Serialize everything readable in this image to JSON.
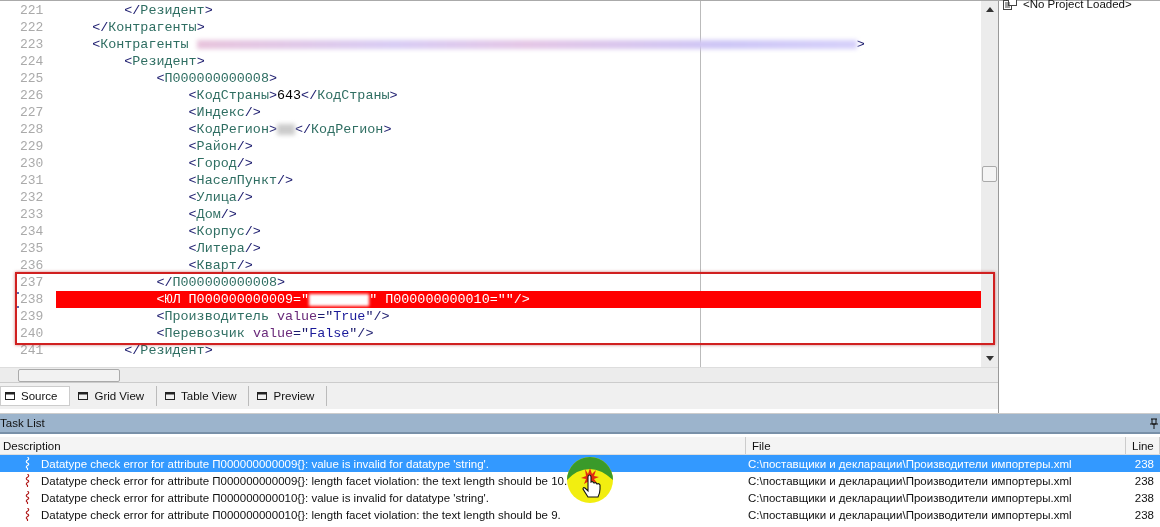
{
  "editor": {
    "lines": [
      {
        "number": "221",
        "error": false,
        "tokens": [
          {
            "kind": "punct",
            "text": "        </"
          },
          {
            "kind": "tag",
            "text": "Резидент"
          },
          {
            "kind": "punct",
            "text": ">"
          }
        ]
      },
      {
        "number": "222",
        "error": false,
        "tokens": [
          {
            "kind": "punct",
            "text": "    </"
          },
          {
            "kind": "tag",
            "text": "Контрагенты"
          },
          {
            "kind": "punct",
            "text": ">"
          }
        ]
      },
      {
        "number": "223",
        "error": false,
        "tokens": [
          {
            "kind": "punct",
            "text": "    <"
          },
          {
            "kind": "tag",
            "text": "Контрагенты "
          },
          {
            "kind": "redacted_long"
          },
          {
            "kind": "punct",
            "text": ">"
          }
        ]
      },
      {
        "number": "224",
        "error": false,
        "tokens": [
          {
            "kind": "punct",
            "text": "        <"
          },
          {
            "kind": "tag",
            "text": "Резидент"
          },
          {
            "kind": "punct",
            "text": ">"
          }
        ]
      },
      {
        "number": "225",
        "error": false,
        "tokens": [
          {
            "kind": "punct",
            "text": "            <"
          },
          {
            "kind": "tag",
            "text": "П000000000008"
          },
          {
            "kind": "punct",
            "text": ">"
          }
        ]
      },
      {
        "number": "226",
        "error": false,
        "tokens": [
          {
            "kind": "punct",
            "text": "                <"
          },
          {
            "kind": "tag",
            "text": "КодСтраны"
          },
          {
            "kind": "punct",
            "text": ">"
          },
          {
            "kind": "text",
            "text": "643"
          },
          {
            "kind": "punct",
            "text": "</"
          },
          {
            "kind": "tag",
            "text": "КодСтраны"
          },
          {
            "kind": "punct",
            "text": ">"
          }
        ]
      },
      {
        "number": "227",
        "error": false,
        "tokens": [
          {
            "kind": "punct",
            "text": "                <"
          },
          {
            "kind": "tag",
            "text": "Индекс"
          },
          {
            "kind": "punct",
            "text": "/>"
          }
        ]
      },
      {
        "number": "228",
        "error": false,
        "tokens": [
          {
            "kind": "punct",
            "text": "                <"
          },
          {
            "kind": "tag",
            "text": "КодРегион"
          },
          {
            "kind": "punct",
            "text": ">"
          },
          {
            "kind": "redacted_short"
          },
          {
            "kind": "punct",
            "text": "</"
          },
          {
            "kind": "tag",
            "text": "КодРегион"
          },
          {
            "kind": "punct",
            "text": ">"
          }
        ]
      },
      {
        "number": "229",
        "error": false,
        "tokens": [
          {
            "kind": "punct",
            "text": "                <"
          },
          {
            "kind": "tag",
            "text": "Район"
          },
          {
            "kind": "punct",
            "text": "/>"
          }
        ]
      },
      {
        "number": "230",
        "error": false,
        "tokens": [
          {
            "kind": "punct",
            "text": "                <"
          },
          {
            "kind": "tag",
            "text": "Город"
          },
          {
            "kind": "punct",
            "text": "/>"
          }
        ]
      },
      {
        "number": "231",
        "error": false,
        "tokens": [
          {
            "kind": "punct",
            "text": "                <"
          },
          {
            "kind": "tag",
            "text": "НаселПункт"
          },
          {
            "kind": "punct",
            "text": "/>"
          }
        ]
      },
      {
        "number": "232",
        "error": false,
        "tokens": [
          {
            "kind": "punct",
            "text": "                <"
          },
          {
            "kind": "tag",
            "text": "Улица"
          },
          {
            "kind": "punct",
            "text": "/>"
          }
        ]
      },
      {
        "number": "233",
        "error": false,
        "tokens": [
          {
            "kind": "punct",
            "text": "                <"
          },
          {
            "kind": "tag",
            "text": "Дом"
          },
          {
            "kind": "punct",
            "text": "/>"
          }
        ]
      },
      {
        "number": "234",
        "error": false,
        "tokens": [
          {
            "kind": "punct",
            "text": "                <"
          },
          {
            "kind": "tag",
            "text": "Корпус"
          },
          {
            "kind": "punct",
            "text": "/>"
          }
        ]
      },
      {
        "number": "235",
        "error": false,
        "tokens": [
          {
            "kind": "punct",
            "text": "                <"
          },
          {
            "kind": "tag",
            "text": "Литера"
          },
          {
            "kind": "punct",
            "text": "/>"
          }
        ]
      },
      {
        "number": "236",
        "error": false,
        "tokens": [
          {
            "kind": "punct",
            "text": "                <"
          },
          {
            "kind": "tag",
            "text": "Кварт"
          },
          {
            "kind": "punct",
            "text": "/>"
          }
        ]
      },
      {
        "number": "237",
        "error": false,
        "tokens": [
          {
            "kind": "punct",
            "text": "            </"
          },
          {
            "kind": "tag",
            "text": "П000000000008"
          },
          {
            "kind": "punct",
            "text": ">"
          }
        ]
      },
      {
        "number": "238",
        "error": true,
        "tokens": [
          {
            "kind": "punct",
            "text": "            <"
          },
          {
            "kind": "tag",
            "text": "ЮЛ "
          },
          {
            "kind": "attr",
            "text": "П000000000009"
          },
          {
            "kind": "punct",
            "text": "=\""
          },
          {
            "kind": "redacted_white"
          },
          {
            "kind": "punct",
            "text": "\" "
          },
          {
            "kind": "attr",
            "text": "П000000000010"
          },
          {
            "kind": "punct",
            "text": "=\"\"/>"
          }
        ]
      },
      {
        "number": "239",
        "error": false,
        "tokens": [
          {
            "kind": "punct",
            "text": "            <"
          },
          {
            "kind": "tag",
            "text": "Производитель "
          },
          {
            "kind": "attr",
            "text": "value"
          },
          {
            "kind": "punct",
            "text": "=\""
          },
          {
            "kind": "str",
            "text": "True"
          },
          {
            "kind": "punct",
            "text": "\"/>"
          }
        ]
      },
      {
        "number": "240",
        "error": false,
        "tokens": [
          {
            "kind": "punct",
            "text": "            <"
          },
          {
            "kind": "tag",
            "text": "Перевозчик "
          },
          {
            "kind": "attr",
            "text": "value"
          },
          {
            "kind": "punct",
            "text": "=\""
          },
          {
            "kind": "str",
            "text": "False"
          },
          {
            "kind": "punct",
            "text": "\"/>"
          }
        ]
      },
      {
        "number": "241",
        "error": false,
        "tokens": [
          {
            "kind": "punct",
            "text": "        </"
          },
          {
            "kind": "tag",
            "text": "Резидент"
          },
          {
            "kind": "punct",
            "text": ">"
          }
        ]
      }
    ]
  },
  "view_tabs": [
    {
      "label": "Source",
      "selected": true
    },
    {
      "label": "Grid View",
      "selected": false
    },
    {
      "label": "Table View",
      "selected": false
    },
    {
      "label": "Preview",
      "selected": false
    }
  ],
  "project_panel": {
    "text": "<No Project Loaded>"
  },
  "task_list": {
    "title": "Task List",
    "columns": [
      "Description",
      "File",
      "Line"
    ],
    "rows": [
      {
        "selected": true,
        "description": "Datatype check error for attribute П000000000009{}: value is invalid for datatype 'string'.",
        "file": "C:\\поставщики и декларации\\Производители импортеры.xml",
        "line": "238"
      },
      {
        "selected": false,
        "description": "Datatype check error for attribute П000000000009{}: length facet violation: the text length should be 10.",
        "file": "C:\\поставщики и декларации\\Производители импортеры.xml",
        "line": "238"
      },
      {
        "selected": false,
        "description": "Datatype check error for attribute П000000000010{}: value is invalid for datatype 'string'.",
        "file": "C:\\поставщики и декларации\\Производители импортеры.xml",
        "line": "238"
      },
      {
        "selected": false,
        "description": "Datatype check error for attribute П000000000010{}: length facet violation: the text length should be 9.",
        "file": "C:\\поставщики и декларации\\Производители импортеры.xml",
        "line": "238"
      }
    ]
  }
}
